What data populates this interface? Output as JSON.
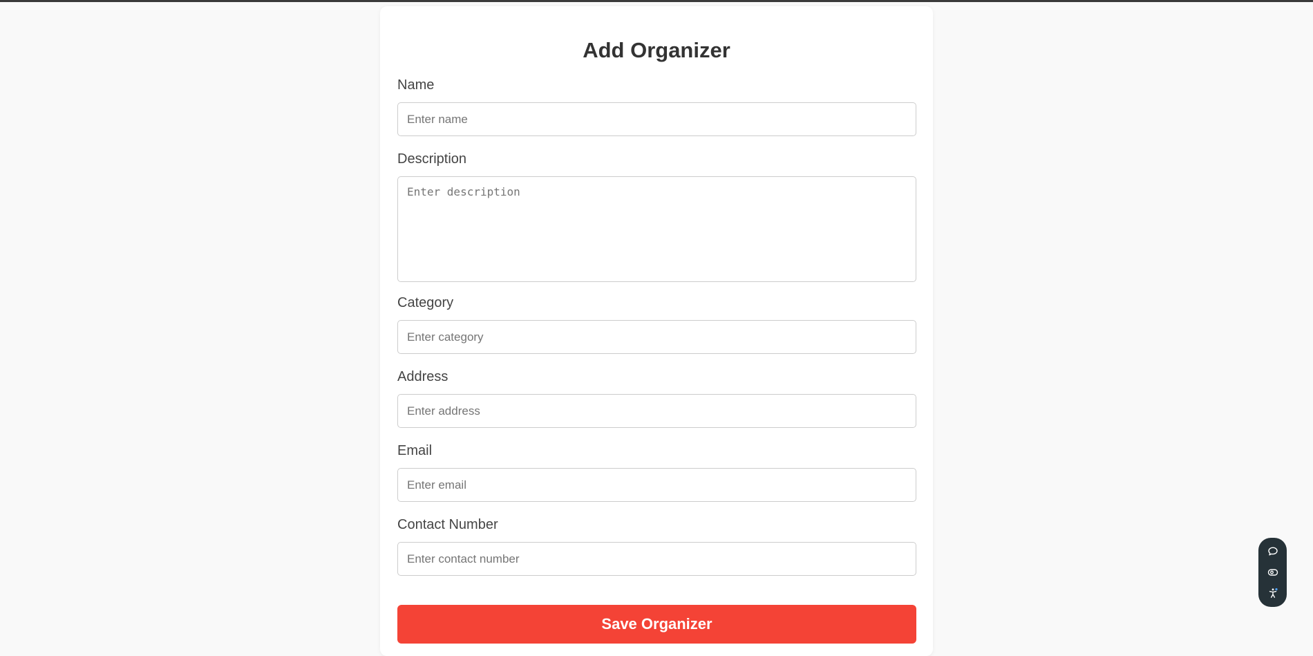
{
  "form": {
    "title": "Add Organizer",
    "fields": {
      "name": {
        "label": "Name",
        "placeholder": "Enter name",
        "value": ""
      },
      "description": {
        "label": "Description",
        "placeholder": "Enter description",
        "value": ""
      },
      "category": {
        "label": "Category",
        "placeholder": "Enter category",
        "value": ""
      },
      "address": {
        "label": "Address",
        "placeholder": "Enter address",
        "value": ""
      },
      "email": {
        "label": "Email",
        "placeholder": "Enter email",
        "value": ""
      },
      "contact": {
        "label": "Contact Number",
        "placeholder": "Enter contact number",
        "value": ""
      }
    },
    "submit_label": "Save Organizer"
  },
  "toolbar": {
    "icons": [
      "chat-bubble-icon",
      "eye-icon",
      "accessibility-icon"
    ]
  },
  "colors": {
    "accent": "#f44336",
    "background": "#f9f9f9",
    "card": "#ffffff",
    "toolbar": "#263238"
  }
}
